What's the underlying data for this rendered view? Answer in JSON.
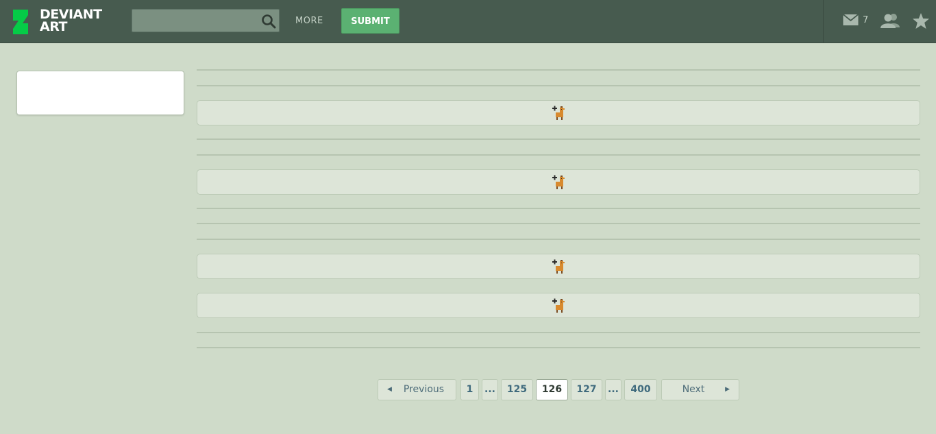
{
  "header": {
    "logo_line1": "DEVIANT",
    "logo_line2": "ART",
    "search_placeholder": "",
    "more_label": "MORE",
    "submit_label": "SUBMIT",
    "mail_count": "7"
  },
  "feed": {
    "cards": [
      {
        "icon": "llama-badge-icon"
      },
      {
        "icon": "llama-badge-icon"
      },
      {
        "icon": "llama-badge-icon"
      },
      {
        "icon": "llama-badge-icon"
      }
    ]
  },
  "pagination": {
    "previous_label": "Previous",
    "next_label": "Next",
    "pages": [
      "1",
      "...",
      "125",
      "126",
      "127",
      "...",
      "400"
    ],
    "current_page": "126"
  },
  "colors": {
    "topbar": "#475b4f",
    "background": "#cfdbc9",
    "submit": "#5bb172",
    "logo_accent": "#05cc47"
  }
}
